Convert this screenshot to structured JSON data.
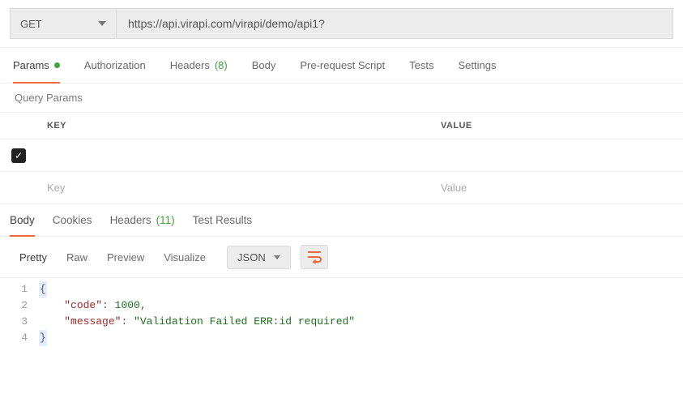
{
  "request": {
    "method": "GET",
    "url": "https://api.virapi.com/virapi/demo/api1?"
  },
  "tabs": {
    "params": "Params",
    "auth": "Authorization",
    "headers": "Headers",
    "headers_count": "(8)",
    "body": "Body",
    "prerequest": "Pre-request Script",
    "tests": "Tests",
    "settings": "Settings"
  },
  "query": {
    "section": "Query Params",
    "key_header": "KEY",
    "value_header": "VALUE",
    "key_placeholder": "Key",
    "value_placeholder": "Value"
  },
  "response_tabs": {
    "body": "Body",
    "cookies": "Cookies",
    "headers": "Headers",
    "headers_count": "(11)",
    "test_results": "Test Results"
  },
  "toolbar": {
    "pretty": "Pretty",
    "raw": "Raw",
    "preview": "Preview",
    "visualize": "Visualize",
    "format": "JSON"
  },
  "response_body": {
    "line1": "{",
    "line2_key": "\"code\"",
    "line2_colon": ": ",
    "line2_val": "1000",
    "line2_comma": ",",
    "line3_key": "\"message\"",
    "line3_colon": ": ",
    "line3_val": "\"Validation Failed ERR:id required\"",
    "line4": "}"
  },
  "chart_data": null
}
